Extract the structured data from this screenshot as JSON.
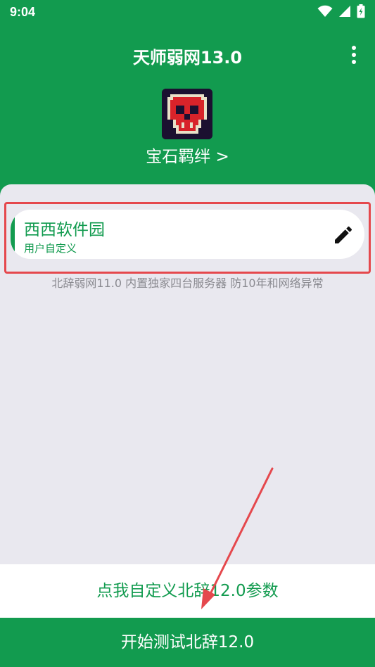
{
  "status_bar": {
    "time": "9:04",
    "icons": [
      "wifi-icon",
      "signal-icon",
      "battery-charging-icon"
    ]
  },
  "header": {
    "title": "天师弱网13.0",
    "menu_icon": "more-vertical-icon",
    "avatar_icon": "pixel-skull-icon",
    "profile_link": "宝石羁绊 >"
  },
  "config_card": {
    "title": "西西软件园",
    "subtitle": "用户自定义",
    "edit_icon": "pencil-icon"
  },
  "notice": "北辞弱网11.0 内置独家四台服务器 防10年和网络异常",
  "buttons": {
    "customize_label": "点我自定义北辞12.0参数",
    "start_label": "开始测试北辞12.0"
  },
  "colors": {
    "primary": "#129b4f",
    "background": "#e9e8ef",
    "annotation": "#e5484d"
  }
}
